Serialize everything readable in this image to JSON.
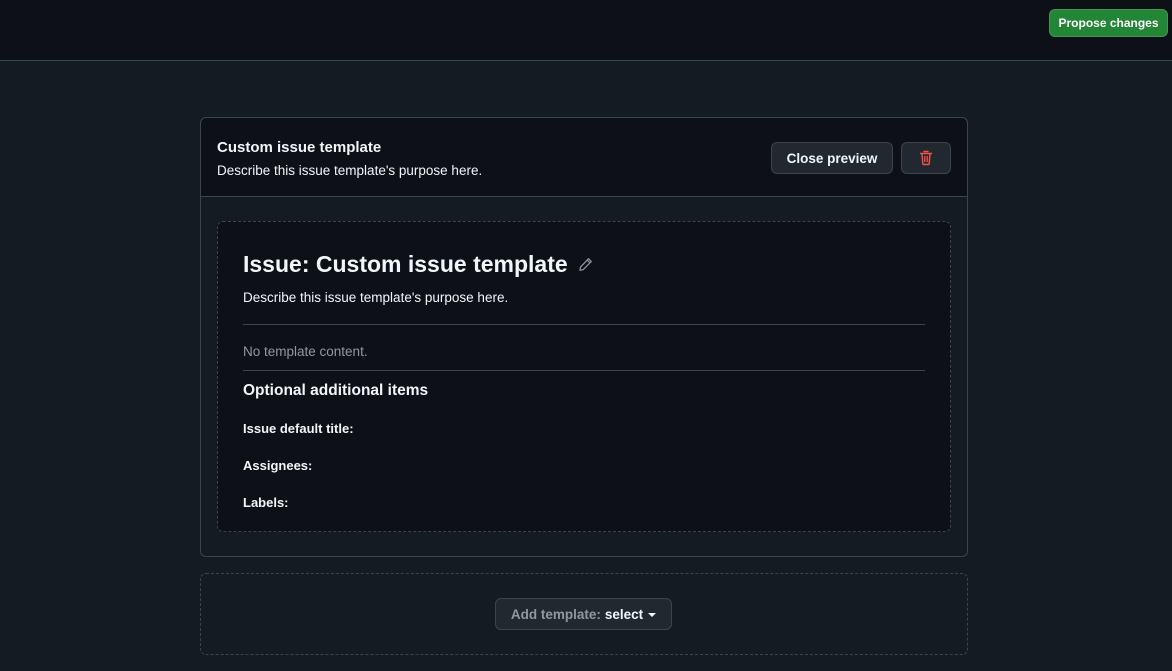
{
  "header": {
    "propose_label": "Propose changes"
  },
  "template_card": {
    "title": "Custom issue template",
    "description": "Describe this issue template's purpose here.",
    "close_preview_label": "Close preview",
    "delete_icon": "trash-icon"
  },
  "preview": {
    "heading": "Issue: Custom issue template",
    "edit_icon": "pencil-icon",
    "description": "Describe this issue template's purpose here.",
    "empty_text": "No template content.",
    "optional_heading": "Optional additional items",
    "fields": [
      {
        "label": "Issue default title:"
      },
      {
        "label": "Assignees:"
      },
      {
        "label": "Labels:"
      }
    ]
  },
  "add_template": {
    "prefix": "Add template:",
    "value": "select",
    "caret_icon": "triangle-down-icon"
  },
  "colors": {
    "primary_button": "#238636",
    "danger": "#f85149",
    "background": "#151b23",
    "surface": "#0d1117",
    "border": "#3d444d"
  }
}
